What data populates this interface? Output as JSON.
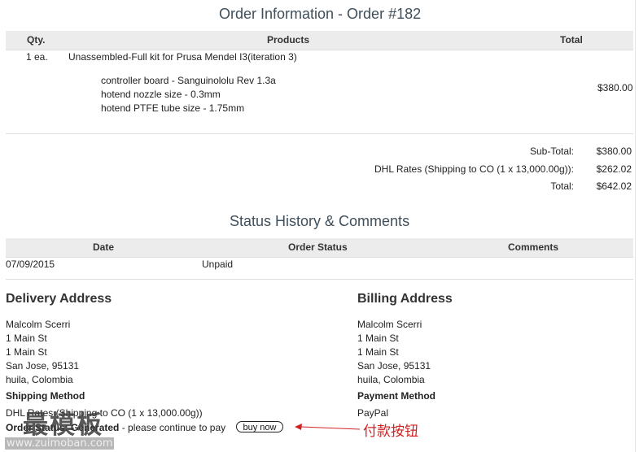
{
  "order": {
    "title": "Order Information - Order #182",
    "columns": {
      "qty": "Qty.",
      "products": "Products",
      "total": "Total"
    },
    "item": {
      "qty": "1 ea.",
      "name": "Unassembled-Full kit for Prusa Mendel I3(iteration 3)",
      "options": [
        "controller board - Sanguinololu Rev 1.3a",
        "hotend nozzle size - 0.3mm",
        "hotend PTFE tube size - 1.75mm"
      ],
      "price": "$380.00"
    },
    "totals": [
      {
        "label": "Sub-Total:",
        "value": "$380.00"
      },
      {
        "label": "DHL Rates (Shipping to CO (1 x 13,000.00g)):",
        "value": "$262.02"
      },
      {
        "label": "Total:",
        "value": "$642.02"
      }
    ]
  },
  "status": {
    "title": "Status History & Comments",
    "columns": {
      "date": "Date",
      "order_status": "Order Status",
      "comments": "Comments"
    },
    "rows": [
      {
        "date": "07/09/2015",
        "order_status": "Unpaid",
        "comments": ""
      }
    ]
  },
  "delivery": {
    "heading": "Delivery Address",
    "lines": [
      "Malcolm Scerri",
      "1 Main St",
      "1 Main St",
      "San Jose, 95131",
      "huila, Colombia"
    ],
    "method_heading": "Shipping Method",
    "method": "DHL Rates (Shipping to CO (1 x 13,000.00g))"
  },
  "billing": {
    "heading": "Billing Address",
    "lines": [
      "Malcolm Scerri",
      "1 Main St",
      "1 Main St",
      "San Jose, 95131",
      "huila, Colombia"
    ],
    "method_heading": "Payment Method",
    "method": "PayPal"
  },
  "order_status": {
    "prefix": "Order Status: Generated",
    "message": " - please continue to pay",
    "button": "buy now"
  },
  "watermark": {
    "text": "最模板",
    "url": "www.zuimoban.com"
  },
  "annotation": {
    "label": "付款按钮",
    "color": "#d02020"
  }
}
